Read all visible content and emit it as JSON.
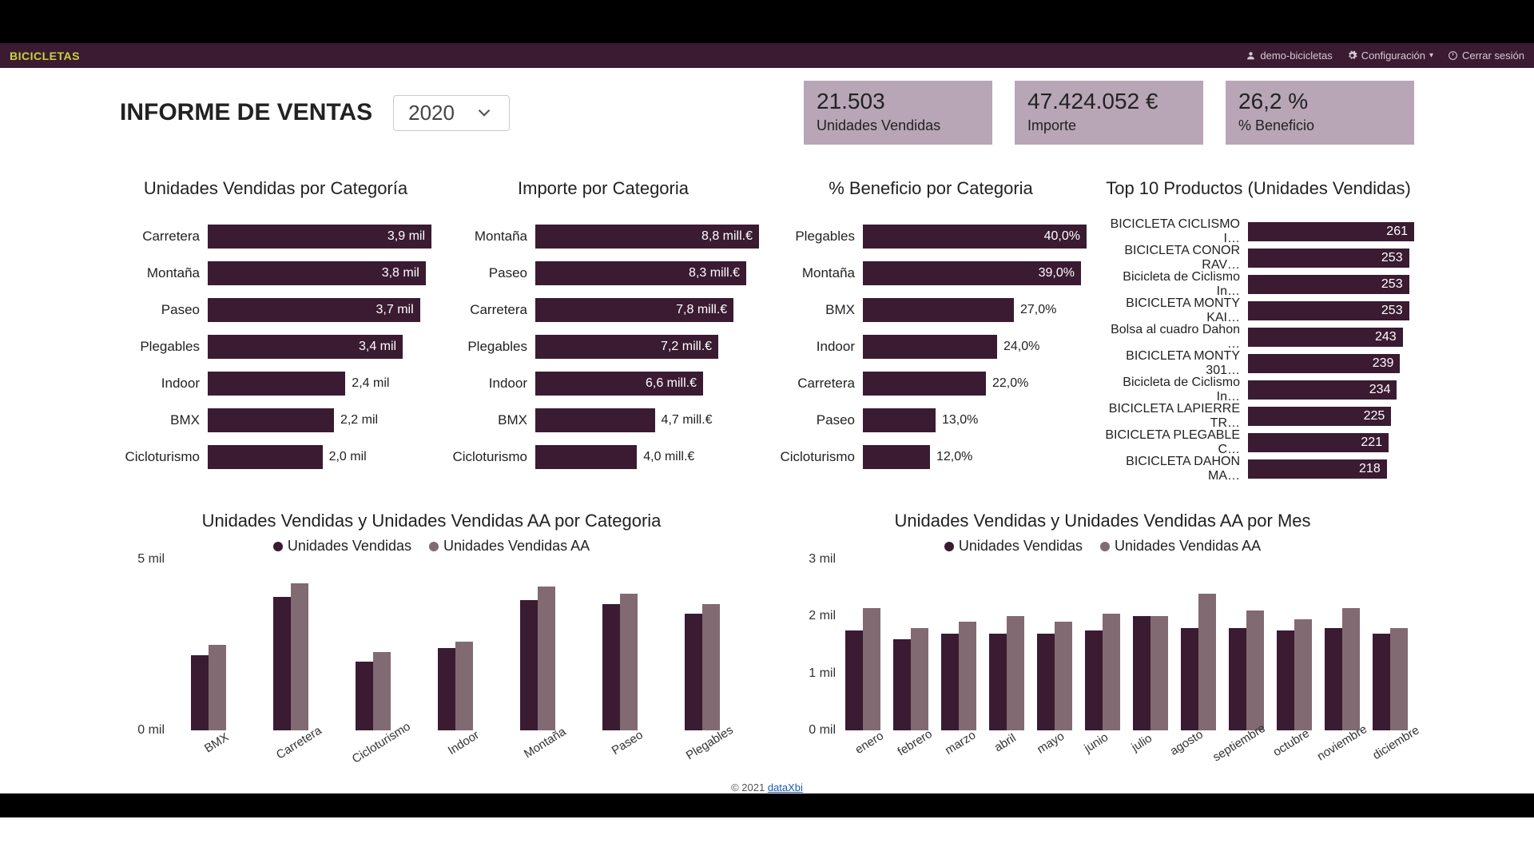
{
  "nav": {
    "brand": "BICICLETAS",
    "user": "demo-bicicletas",
    "config": "Configuración",
    "logout": "Cerrar sesión"
  },
  "header": {
    "title": "INFORME DE VENTAS",
    "year": "2020"
  },
  "kpis": [
    {
      "value": "21.503",
      "label": "Unidades Vendidas"
    },
    {
      "value": "47.424.052 €",
      "label": "Importe"
    },
    {
      "value": "26,2 %",
      "label": "% Beneficio"
    }
  ],
  "chart_data": [
    {
      "id": "unidades_categoria",
      "type": "bar",
      "orientation": "horizontal",
      "title": "Unidades Vendidas por Categoría",
      "categories": [
        "Carretera",
        "Montaña",
        "Paseo",
        "Plegables",
        "Indoor",
        "BMX",
        "Cicloturismo"
      ],
      "values": [
        3900,
        3800,
        3700,
        3400,
        2400,
        2200,
        2000
      ],
      "display": [
        "3,9 mil",
        "3,8 mil",
        "3,7 mil",
        "3,4 mil",
        "2,4 mil",
        "2,2 mil",
        "2,0 mil"
      ],
      "max": 3900
    },
    {
      "id": "importe_categoria",
      "type": "bar",
      "orientation": "horizontal",
      "title": "Importe por Categoria",
      "categories": [
        "Montaña",
        "Paseo",
        "Carretera",
        "Plegables",
        "Indoor",
        "BMX",
        "Cicloturismo"
      ],
      "values": [
        8800000,
        8300000,
        7800000,
        7200000,
        6600000,
        4700000,
        4000000
      ],
      "display": [
        "8,8 mill.€",
        "8,3 mill.€",
        "7,8 mill.€",
        "7,2 mill.€",
        "6,6 mill.€",
        "4,7 mill.€",
        "4,0 mill.€"
      ],
      "max": 8800000
    },
    {
      "id": "beneficio_categoria",
      "type": "bar",
      "orientation": "horizontal",
      "title": "% Beneficio por Categoria",
      "categories": [
        "Plegables",
        "Montaña",
        "BMX",
        "Indoor",
        "Carretera",
        "Paseo",
        "Cicloturismo"
      ],
      "values": [
        40.0,
        39.0,
        27.0,
        24.0,
        22.0,
        13.0,
        12.0
      ],
      "display": [
        "40,0%",
        "39,0%",
        "27,0%",
        "24,0%",
        "22,0%",
        "13,0%",
        "12,0%"
      ],
      "max": 40.0
    },
    {
      "id": "top10",
      "type": "bar",
      "orientation": "horizontal",
      "title": "Top 10 Productos (Unidades Vendidas)",
      "categories": [
        "BICICLETA CICLISMO I…",
        "BICICLETA CONOR RAV…",
        "Bicicleta de Ciclismo In…",
        "BICICLETA MONTY KAI…",
        "Bolsa al cuadro Dahon …",
        "BICICLETA MONTY 301…",
        "Bicicleta de Ciclismo In…",
        "BICICLETA LAPIERRE TR…",
        "BICICLETA PLEGABLE C…",
        "BICICLETA DAHON MA…"
      ],
      "values": [
        261,
        253,
        253,
        253,
        243,
        239,
        234,
        225,
        221,
        218
      ],
      "display": [
        "261",
        "253",
        "253",
        "253",
        "243",
        "239",
        "234",
        "225",
        "221",
        "218"
      ],
      "max": 261
    },
    {
      "id": "uv_aa_categoria",
      "type": "bar",
      "orientation": "vertical",
      "title": "Unidades Vendidas y Unidades Vendidas AA por Categoria",
      "categories": [
        "BMX",
        "Carretera",
        "Cicloturismo",
        "Indoor",
        "Montaña",
        "Paseo",
        "Plegables"
      ],
      "series": [
        {
          "name": "Unidades Vendidas",
          "values": [
            2200,
            3900,
            2000,
            2400,
            3800,
            3700,
            3400
          ]
        },
        {
          "name": "Unidades Vendidas AA",
          "values": [
            2500,
            4300,
            2300,
            2600,
            4200,
            4000,
            3700
          ]
        }
      ],
      "ylim": [
        0,
        5000
      ],
      "yticks": [
        0,
        5000
      ],
      "ytick_display": [
        "0 mil",
        "5 mil"
      ]
    },
    {
      "id": "uv_aa_mes",
      "type": "bar",
      "orientation": "vertical",
      "title": "Unidades Vendidas y Unidades Vendidas AA por Mes",
      "categories": [
        "enero",
        "febrero",
        "marzo",
        "abril",
        "mayo",
        "junio",
        "julio",
        "agosto",
        "septiembre",
        "octubre",
        "noviembre",
        "diciembre"
      ],
      "series": [
        {
          "name": "Unidades Vendidas",
          "values": [
            1750,
            1600,
            1700,
            1700,
            1700,
            1750,
            2000,
            1800,
            1800,
            1750,
            1800,
            1700
          ]
        },
        {
          "name": "Unidades Vendidas AA",
          "values": [
            2150,
            1800,
            1900,
            2000,
            1900,
            2050,
            2000,
            2400,
            2100,
            1950,
            2150,
            1800
          ]
        }
      ],
      "ylim": [
        0,
        3000
      ],
      "yticks": [
        0,
        1000,
        2000,
        3000
      ],
      "ytick_display": [
        "0 mil",
        "1 mil",
        "2 mil",
        "3 mil"
      ]
    }
  ],
  "legend_labels": [
    "Unidades Vendidas",
    "Unidades Vendidas AA"
  ],
  "colors": {
    "series_a": "#3a1b32",
    "series_b": "#826a72"
  },
  "footer": {
    "copyright": "© 2021 ",
    "link": "dataXbi"
  }
}
